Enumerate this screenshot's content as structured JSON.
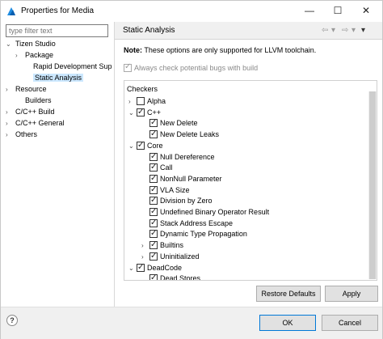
{
  "window": {
    "title": "Properties for Media"
  },
  "filter": {
    "placeholder": "type filter text"
  },
  "left_tree": [
    {
      "label": "Tizen Studio",
      "arrow": "⌄",
      "selected": false
    },
    {
      "label": "Package",
      "arrow": "›",
      "selected": false
    },
    {
      "label": "Rapid Development Sup",
      "arrow": "",
      "selected": false
    },
    {
      "label": "Static Analysis",
      "arrow": "",
      "selected": true
    },
    {
      "label": "Resource",
      "arrow": "›",
      "selected": false
    },
    {
      "label": "Builders",
      "arrow": "",
      "selected": false
    },
    {
      "label": "C/C++ Build",
      "arrow": "›",
      "selected": false
    },
    {
      "label": "C/C++ General",
      "arrow": "›",
      "selected": false
    },
    {
      "label": "Others",
      "arrow": "›",
      "selected": false
    }
  ],
  "page": {
    "title": "Static Analysis",
    "note_label": "Note:",
    "note_text": "These options are only supported for LLVM toolchain.",
    "always_check_label": "Always check potential bugs with build",
    "checkers_title": "Checkers"
  },
  "checkers": [
    {
      "label": "Alpha",
      "arrow": "›",
      "checked": false
    },
    {
      "label": "C++",
      "arrow": "⌄",
      "checked": true
    },
    {
      "label": "New Delete",
      "arrow": "",
      "checked": true
    },
    {
      "label": "New Delete Leaks",
      "arrow": "",
      "checked": true
    },
    {
      "label": "Core",
      "arrow": "⌄",
      "checked": true
    },
    {
      "label": "Null Dereference",
      "arrow": "",
      "checked": true
    },
    {
      "label": "Call",
      "arrow": "",
      "checked": true
    },
    {
      "label": "NonNull Parameter",
      "arrow": "",
      "checked": true
    },
    {
      "label": "VLA Size",
      "arrow": "",
      "checked": true
    },
    {
      "label": "Division by Zero",
      "arrow": "",
      "checked": true
    },
    {
      "label": "Undefined Binary Operator Result",
      "arrow": "",
      "checked": true
    },
    {
      "label": "Stack Address Escape",
      "arrow": "",
      "checked": true
    },
    {
      "label": "Dynamic Type Propagation",
      "arrow": "",
      "checked": true
    },
    {
      "label": "Builtins",
      "arrow": "›",
      "checked": true
    },
    {
      "label": "Uninitialized",
      "arrow": "›",
      "checked": true
    },
    {
      "label": "DeadCode",
      "arrow": "⌄",
      "checked": true
    },
    {
      "label": "Dead Stores",
      "arrow": "",
      "checked": true
    }
  ],
  "buttons": {
    "restore_defaults": "Restore Defaults",
    "apply": "Apply",
    "ok": "OK",
    "cancel": "Cancel",
    "help": "?"
  },
  "icons": {
    "minimize": "—",
    "maximize": "☐",
    "close": "✕",
    "back": "⇦",
    "forward": "⇨",
    "menu": "▾"
  },
  "colors": {
    "selection": "#cce8ff",
    "accent": "#0078d7"
  }
}
